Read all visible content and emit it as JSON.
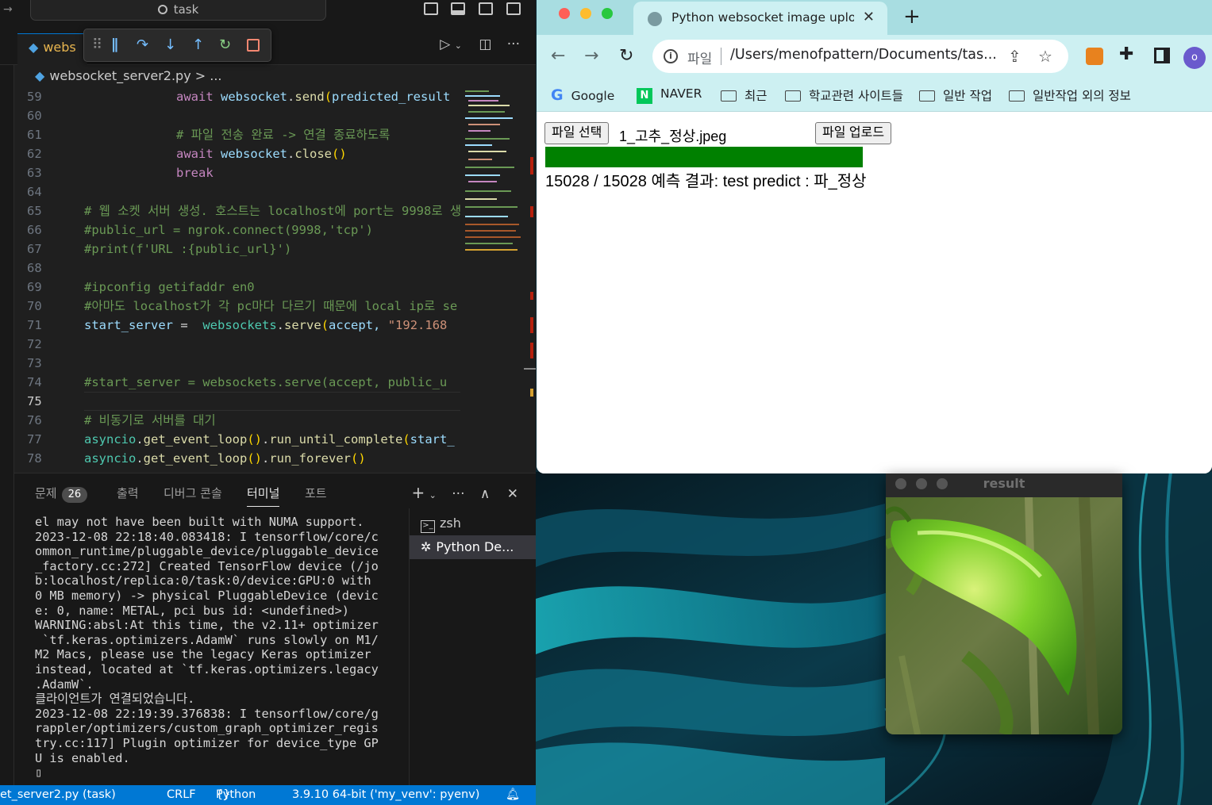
{
  "vscode": {
    "search_text": "task",
    "tab_label": "webs",
    "breadcrumb": "websocket_server2.py",
    "breadcrumb_more": "> ...",
    "lines": [
      {
        "n": "59"
      },
      {
        "n": "60"
      },
      {
        "n": "61"
      },
      {
        "n": "62"
      },
      {
        "n": "63"
      },
      {
        "n": "64"
      },
      {
        "n": "65"
      },
      {
        "n": "66"
      },
      {
        "n": "67"
      },
      {
        "n": "68"
      },
      {
        "n": "69"
      },
      {
        "n": "70"
      },
      {
        "n": "71"
      },
      {
        "n": "72"
      },
      {
        "n": "73"
      },
      {
        "n": "74"
      },
      {
        "n": "75"
      },
      {
        "n": "76"
      },
      {
        "n": "77"
      },
      {
        "n": "78"
      }
    ],
    "code": {
      "l59_kw": "await",
      "l59_obj": "websocket",
      "l59_fn": "send",
      "l59_arg": "predicted_result",
      "l61_cm": "# 파일 전송 완료 -> 연결 종료하도록",
      "l62_kw": "await",
      "l62_obj": "websocket",
      "l62_fn": "close",
      "l63_kw": "break",
      "l65_cm": "# 웹 소켓 서버 생성. 호스트는 localhost에 port는 9998로 생",
      "l66_cm": "#public_url = ngrok.connect(9998,'tcp')",
      "l67_cm": "#print(f'URL :{public_url}')",
      "l69_cm": "#ipconfig getifaddr en0",
      "l70_cm": "#아마도 localhost가 각 pc마다 다르기 때문에 local ip로 se",
      "l71_var": "start_server",
      "l71_obj": "websockets",
      "l71_fn": "serve",
      "l71_arg": "accept,",
      "l71_str": "\"192.168",
      "l74_cm": "#start_server = websockets.serve(accept, public_u",
      "l76_cm": "# 비동기로 서버를 대기",
      "l77_obj": "asyncio",
      "l77_fn1": "get_event_loop",
      "l77_fn2": "run_until_complete",
      "l77_arg": "start_",
      "l78_obj": "asyncio",
      "l78_fn1": "get_event_loop",
      "l78_fn2": "run_forever"
    },
    "panel": {
      "tabs": [
        "문제",
        "출력",
        "디버그 콘솔",
        "터미널",
        "포트"
      ],
      "problems_count": "26",
      "active_tab": "터미널",
      "terminal_lines": [
        "el may not have been built with NUMA support.",
        "2023-12-08 22:18:40.083418: I tensorflow/core/c",
        "ommon_runtime/pluggable_device/pluggable_device",
        "_factory.cc:272] Created TensorFlow device (/jo",
        "b:localhost/replica:0/task:0/device:GPU:0 with",
        "0 MB memory) -> physical PluggableDevice (devic",
        "e: 0, name: METAL, pci bus id: <undefined>)",
        "WARNING:absl:At this time, the v2.11+ optimizer",
        " `tf.keras.optimizers.AdamW` runs slowly on M1/",
        "M2 Macs, please use the legacy Keras optimizer",
        "instead, located at `tf.keras.optimizers.legacy",
        ".AdamW`.",
        "클라이언트가 연결되었습니다.",
        "2023-12-08 22:19:39.376838: I tensorflow/core/g",
        "rappler/optimizers/custom_graph_optimizer_regis",
        "try.cc:117] Plugin optimizer for device_type GP",
        "U is enabled.",
        "▯"
      ],
      "terminals": [
        "zsh",
        "Python De..."
      ]
    },
    "status": {
      "file": "et_server2.py (task)",
      "eol": "CRLF",
      "lang": "Python",
      "interpreter": "3.9.10 64-bit ('my_venv': pyenv)"
    },
    "accent": "#0078d4"
  },
  "chrome": {
    "tab_title": "Python websocket image uplo",
    "url_scheme": "파일",
    "url": "/Users/menofpattern/Documents/tas...",
    "bookmarks": [
      "Google",
      "NAVER",
      "최근",
      "학교관련 사이트들",
      "일반 작업",
      "일반작업 외의 정보"
    ],
    "profile_initial": "o",
    "page": {
      "choose_file_label": "파일 선택",
      "file_name": "1_고추_정상.jpeg",
      "upload_label": "파일 업로드",
      "progress": 1.0,
      "progress_color": "#008000",
      "result_text": "15028 / 15028 예측 결과: test predict : 파_정상"
    }
  },
  "result_window": {
    "title": "result"
  }
}
